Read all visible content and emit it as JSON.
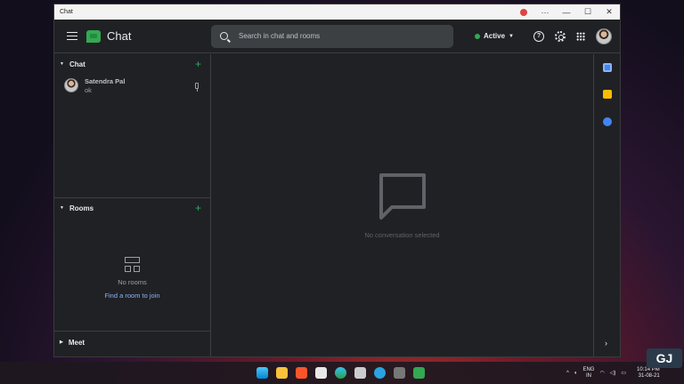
{
  "window": {
    "title": "Chat"
  },
  "header": {
    "app_name": "Chat",
    "search_placeholder": "Search in chat and rooms",
    "status": "Active"
  },
  "sidebar": {
    "chat_section": "Chat",
    "dm": {
      "name": "Satendra Pal",
      "last_message": "ok"
    },
    "rooms_section": "Rooms",
    "no_rooms": "No rooms",
    "find_room": "Find a room to join",
    "meet_section": "Meet"
  },
  "main": {
    "empty_text": "No conversation selected"
  },
  "taskbar": {
    "lang": "ENG",
    "region": "IN",
    "time": "10:14 PM",
    "date": "31-08-21"
  },
  "colors": {
    "accent_green": "#34a853",
    "link_blue": "#8ab4f8",
    "background": "#202124"
  },
  "icons": [
    "menu-icon",
    "chat-logo-icon",
    "search-icon",
    "help-icon",
    "gear-icon",
    "apps-grid-icon",
    "pin-icon",
    "rooms-icon",
    "message-icon",
    "calendar-icon",
    "keep-icon",
    "tasks-icon",
    "chevron-right-icon"
  ]
}
